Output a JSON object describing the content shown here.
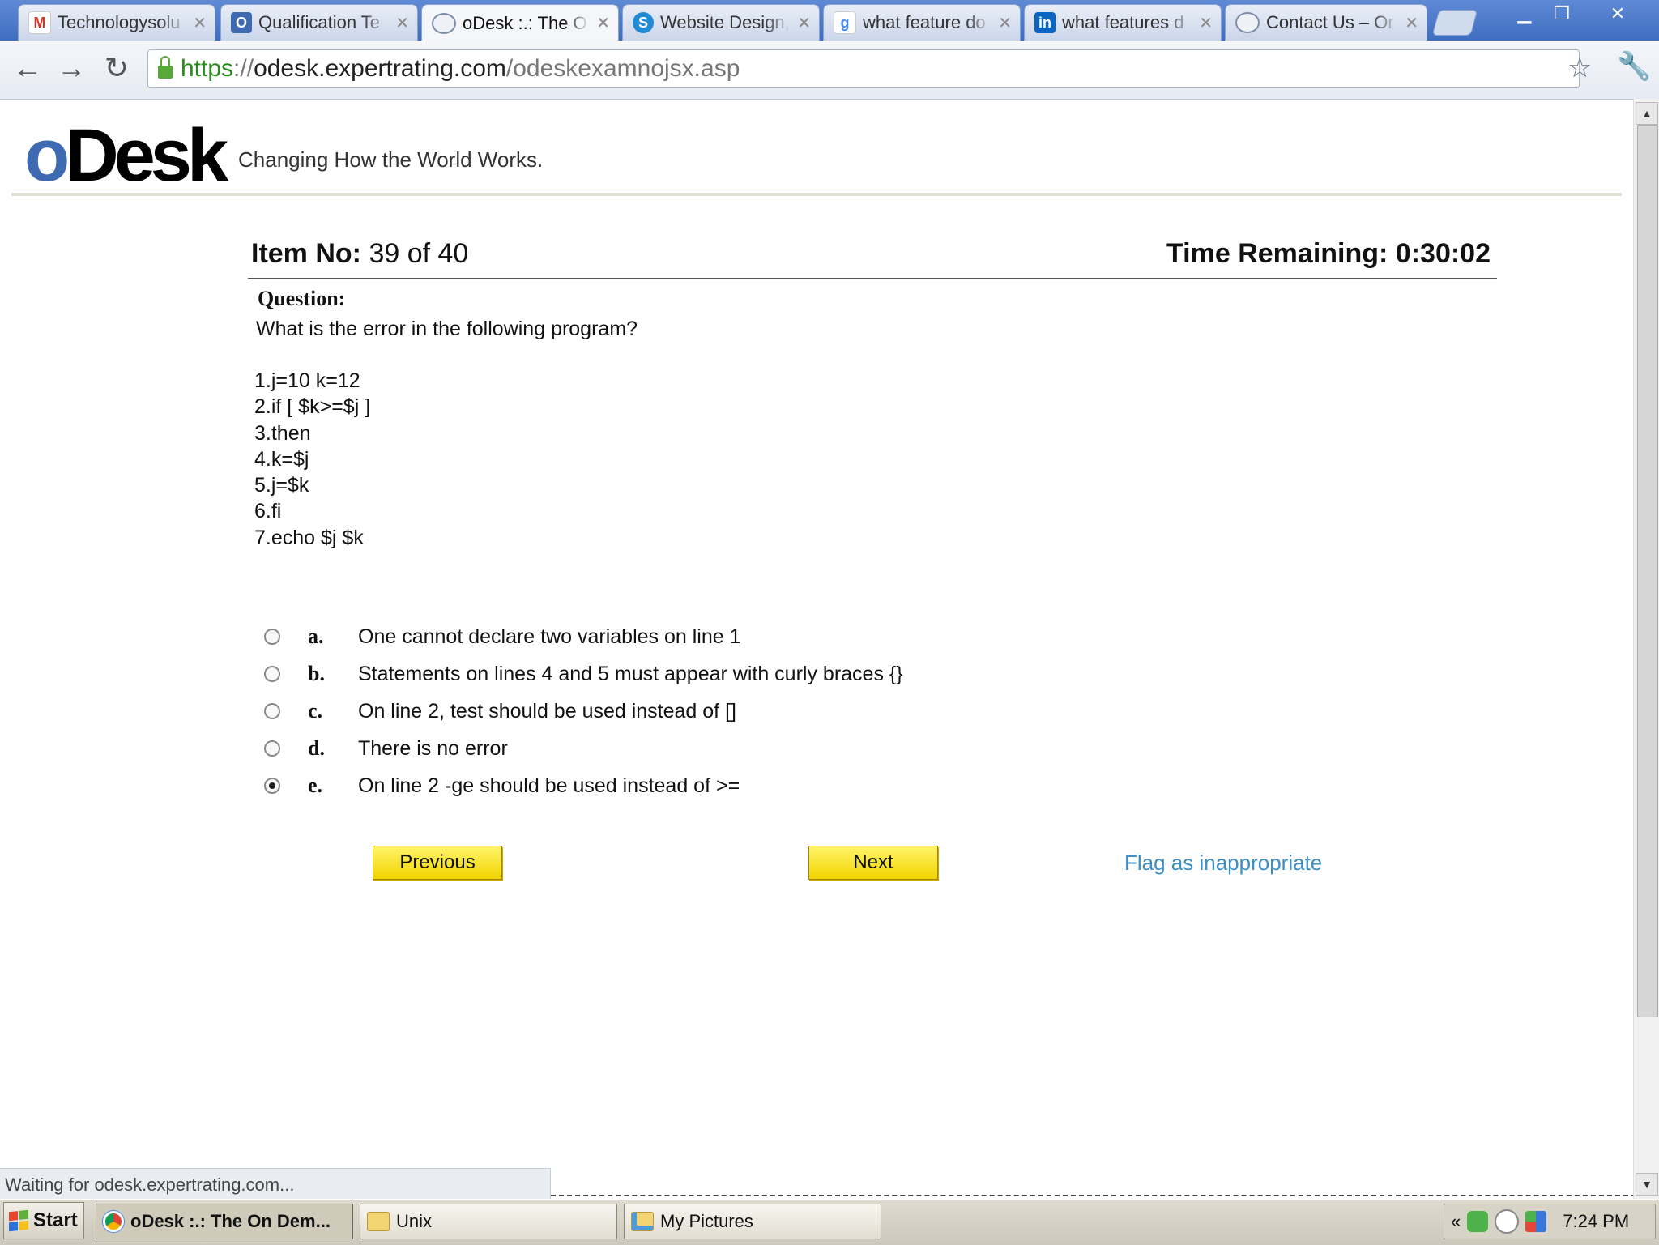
{
  "browser": {
    "tabs": [
      {
        "label": "Technologysolu",
        "favicon": "gmail-icon",
        "color": "#d93025"
      },
      {
        "label": "Qualification Te",
        "favicon": "odesk-o-icon",
        "color": "#3d6ab0"
      },
      {
        "label": "oDesk :.: The O",
        "favicon": "globe-icon",
        "color": "#7f8ea8",
        "active": true
      },
      {
        "label": "Website Design,",
        "favicon": "skype-s-icon",
        "color": "#1f8ad6"
      },
      {
        "label": "what feature do",
        "favicon": "google-icon",
        "color": "#4285f4"
      },
      {
        "label": "what features d",
        "favicon": "linkedin-icon",
        "color": "#0a66c2"
      },
      {
        "label": "Contact Us – Or",
        "favicon": "globe-icon",
        "color": "#7f8ea8"
      }
    ],
    "url": {
      "scheme": "https",
      "sep": "://",
      "host": "odesk.expertrating.com",
      "path": "/odeskexamnojsx.asp"
    },
    "status_text": "Waiting for odesk.expertrating.com..."
  },
  "site": {
    "logo_o": "o",
    "logo_rest": "Desk",
    "tagline": "Changing How the World Works."
  },
  "exam": {
    "item_label": "Item No:",
    "item_value": "39 of 40",
    "time_label": "Time Remaining:",
    "time_value": "0:30:02",
    "question_label": "Question:",
    "question_text": "What is the error in the following program?",
    "code_lines": [
      "1.j=10 k=12",
      "2.if [ $k>=$j ]",
      "3.then",
      "4.k=$j",
      "5.j=$k",
      "6.fi",
      "7.echo $j $k"
    ],
    "options": [
      {
        "letter": "a.",
        "text": "One cannot declare two variables on line 1",
        "selected": false
      },
      {
        "letter": "b.",
        "text": "Statements on lines 4 and 5 must appear with curly braces {}",
        "selected": false
      },
      {
        "letter": "c.",
        "text": "On line 2, test should be used instead of []",
        "selected": false
      },
      {
        "letter": "d.",
        "text": "There is no error",
        "selected": false
      },
      {
        "letter": "e.",
        "text": "On line 2 -ge should be used instead of >=",
        "selected": true
      }
    ],
    "previous_label": "Previous",
    "next_label": "Next",
    "flag_label": "Flag as inappropriate"
  },
  "taskbar": {
    "start_label": "Start",
    "tasks": [
      {
        "label": "oDesk :.: The On Dem...",
        "icon": "chrome-icon",
        "active": true
      },
      {
        "label": "Unix",
        "icon": "folder-icon",
        "active": false
      },
      {
        "label": "My Pictures",
        "icon": "pictures-folder-icon",
        "active": false
      }
    ],
    "tray_chevron": "«",
    "clock": "7:24 PM"
  },
  "colors": {
    "button_yellow": "#f2d400",
    "link_blue": "#3b8fc4",
    "logo_blue": "#3d6ab0",
    "secure_green": "#2a8a1f"
  }
}
